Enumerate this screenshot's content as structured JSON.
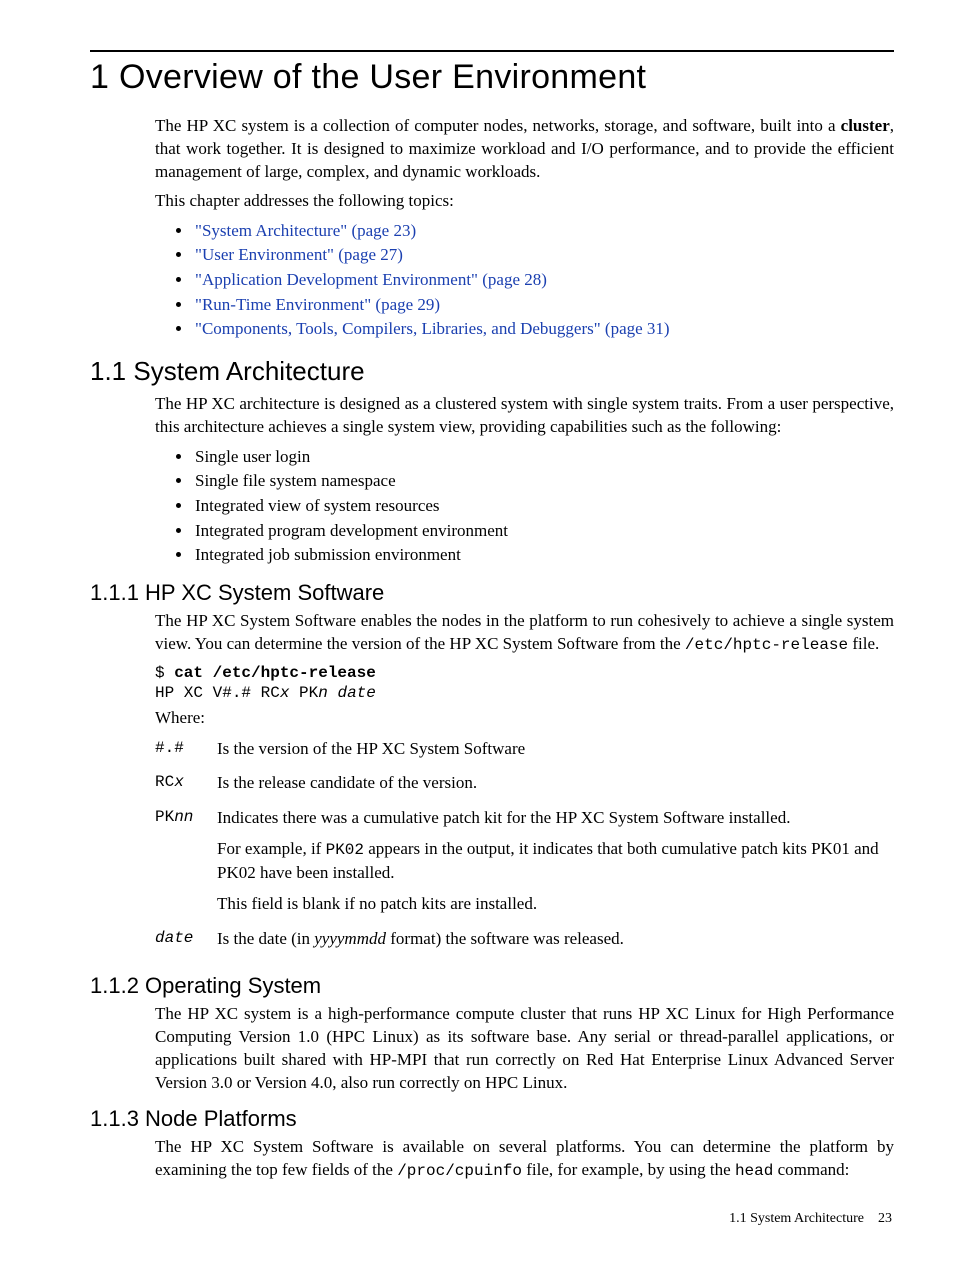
{
  "chapter": {
    "title": "1 Overview of the User Environment"
  },
  "intro": {
    "p1_pre": "The HP XC system is a collection of computer nodes, networks, storage, and software, built into a ",
    "p1_bold": "cluster",
    "p1_post": ", that work together. It is designed to maximize workload and I/O performance, and to provide the efficient management of large, complex, and dynamic workloads.",
    "p2": "This chapter addresses the following topics:",
    "links": [
      "\"System Architecture\" (page 23)",
      "\"User Environment\" (page 27)",
      "\"Application Development Environment\" (page 28)",
      "\"Run-Time Environment\" (page 29)",
      "\"Components, Tools, Compilers, Libraries, and Debuggers\" (page 31)"
    ]
  },
  "s11": {
    "title": "1.1 System Architecture",
    "p1": "The HP XC architecture is designed as a clustered system with single system traits. From a user perspective, this architecture achieves a single system view, providing capabilities such as the following:",
    "bullets": [
      "Single user login",
      "Single file system namespace",
      "Integrated view of system resources",
      "Integrated program development environment",
      "Integrated job submission environment"
    ]
  },
  "s111": {
    "title": "1.1.1 HP XC System Software",
    "p1_a": "The HP XC System Software enables the nodes in the platform to run cohesively to achieve a single system view. You can determine the version of the HP XC System Software from the ",
    "p1_code": "/etc/hptc-release",
    "p1_b": " file.",
    "code_prompt": "$ ",
    "code_cmd": "cat /etc/hptc-release",
    "code_out_a": "HP XC V#.# RC",
    "code_out_x": "x",
    "code_out_b": " PK",
    "code_out_n": "n",
    "code_out_c": " ",
    "code_out_date": "date",
    "where": "Where:",
    "defs": {
      "t1": "#.#",
      "d1": "Is the version of the HP XC System Software",
      "t2_a": "RC",
      "t2_b": "x",
      "d2": "Is the release candidate of the version.",
      "t3_a": "PK",
      "t3_b": "nn",
      "d3a_pre": "Indicates there was a cumulative patch kit for the HP XC System Software installed.",
      "d3b_pre": "For example, if ",
      "d3b_code": "PK02",
      "d3b_post": " appears in the output, it indicates that both cumulative patch kits PK01 and PK02 have been installed.",
      "d3c": "This field is blank if no patch kits are installed.",
      "t4": "date",
      "d4_pre": "Is the date (in ",
      "d4_it": "yyyymmdd",
      "d4_post": " format) the software was released."
    }
  },
  "s112": {
    "title": "1.1.2 Operating System",
    "p1": "The HP XC system is a high-performance compute cluster that runs HP XC Linux for High Performance Computing Version 1.0 (HPC Linux) as its software base. Any serial or thread-parallel applications, or applications built shared with HP-MPI that run correctly on Red Hat Enterprise Linux Advanced Server Version 3.0 or Version 4.0, also run correctly on HPC Linux."
  },
  "s113": {
    "title": "1.1.3 Node Platforms",
    "p1_a": "The HP XC System Software is available on several platforms. You can determine the platform by examining the top few fields of the ",
    "p1_code1": "/proc/cpuinfo",
    "p1_b": " file, for example, by using the ",
    "p1_code2": "head",
    "p1_c": " command:"
  },
  "footer": {
    "section": "1.1 System Architecture",
    "page": "23"
  }
}
